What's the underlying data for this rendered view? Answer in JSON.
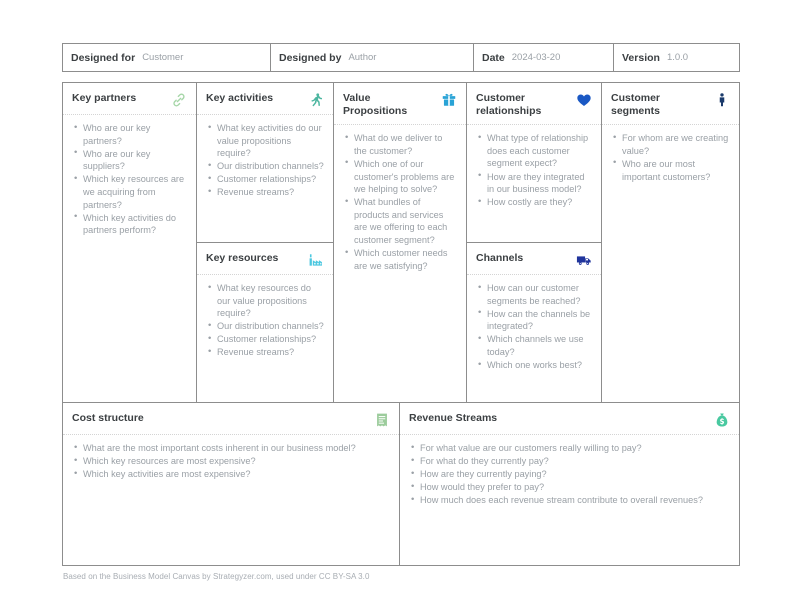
{
  "header": {
    "fields": [
      {
        "label": "Designed for",
        "value": "Customer"
      },
      {
        "label": "Designed by",
        "value": "Author"
      },
      {
        "label": "Date",
        "value": "2024-03-20"
      },
      {
        "label": "Version",
        "value": "1.0.0"
      }
    ]
  },
  "blocks": {
    "key_partners": {
      "title": "Key partners",
      "icon": "link-chain-icon",
      "icon_color": "#a5d6a7",
      "points": [
        "Who are our key partners?",
        "Who are our key suppliers?",
        "Which key resources are we acquiring from partners?",
        "Which key activities do partners perform?"
      ]
    },
    "key_activities": {
      "title": "Key activities",
      "icon": "running-person-icon",
      "icon_color": "#4db6a0",
      "points": [
        "What key activities do our value propositions require?",
        "Our distribution channels?",
        "Customer relationships?",
        "Revenue streams?"
      ]
    },
    "key_resources": {
      "title": "Key resources",
      "icon": "factory-icon",
      "icon_color": "#4dc8e0",
      "points": [
        "What key resources do our value propositions require?",
        "Our distribution channels?",
        "Customer relationships?",
        "Revenue streams?"
      ]
    },
    "value_propositions": {
      "title": "Value Propositions",
      "icon": "gift-icon",
      "icon_color": "#29a3d6",
      "points": [
        "What do we deliver to the customer?",
        "Which one of our customer's problems are we helping to solve?",
        "What bundles of products and services are we offering to each customer segment?",
        "Which customer needs are we satisfying?"
      ]
    },
    "customer_relationships": {
      "title": "Customer relationships",
      "icon": "heart-icon",
      "icon_color": "#1a58c4",
      "points": [
        "What type of relationship does each customer segment expect?",
        "How are they integrated in our business model?",
        "How costly are they?"
      ]
    },
    "channels": {
      "title": "Channels",
      "icon": "delivery-truck-icon",
      "icon_color": "#20349c",
      "points": [
        "How can our customer segments be reached?",
        "How can the channels be integrated?",
        "Which channels we use today?",
        "Which one works best?"
      ]
    },
    "customer_segments": {
      "title": "Customer segments",
      "icon": "person-icon",
      "icon_color": "#1b3a6b",
      "points": [
        "For whom are we creating value?",
        "Who are our most important customers?"
      ]
    },
    "cost_structure": {
      "title": "Cost structure",
      "icon": "receipt-icon",
      "icon_color": "#9ccc9c",
      "points": [
        "What are the most important costs inherent in our business model?",
        "Which key resources are most expensive?",
        "Which key activities are most expensive?"
      ]
    },
    "revenue_streams": {
      "title": "Revenue Streams",
      "icon": "money-bag-icon",
      "icon_color": "#49c9a0",
      "points": [
        "For what value are our customers really willing to pay?",
        "For what do they currently pay?",
        "How are they currently paying?",
        "How would they prefer to pay?",
        "How much does each revenue stream contribute to overall revenues?"
      ]
    }
  },
  "footer": {
    "note": "Based on the Business Model Canvas by Strategyzer.com, used under CC BY-SA 3.0"
  }
}
